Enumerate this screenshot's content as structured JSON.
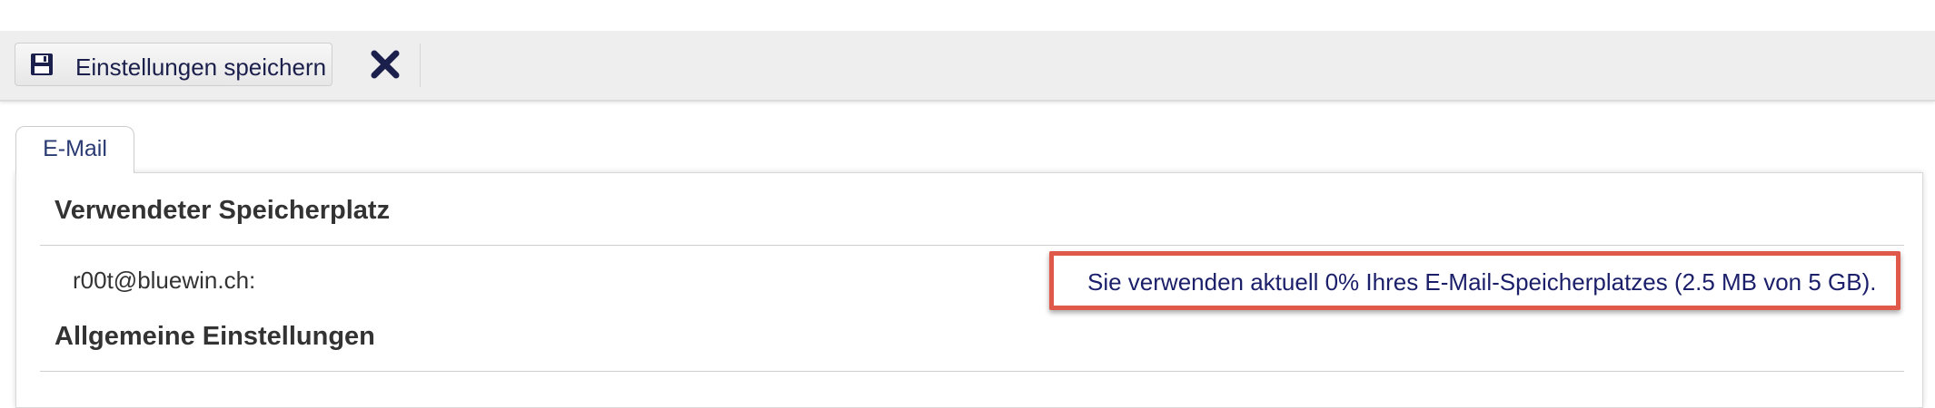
{
  "toolbar": {
    "save_label": "Einstellungen speichern",
    "save_icon": "floppy-disk-icon",
    "close_icon": "close-icon"
  },
  "tabs": [
    {
      "label": "E-Mail",
      "active": true
    }
  ],
  "storage": {
    "title": "Verwendeter Speicherplatz",
    "account": "r00t@bluewin.ch:",
    "usage_text": "Sie verwenden aktuell 0% Ihres E-Mail-Speicherplatzes (2.5 MB von 5 GB)."
  },
  "general": {
    "title": "Allgemeine Einstellungen"
  },
  "colors": {
    "text_dark_blue": "#1b1f4c",
    "highlight_border": "#e0584a",
    "tab_text": "#2a3a72",
    "toolbar_bg": "#eeeeee"
  }
}
